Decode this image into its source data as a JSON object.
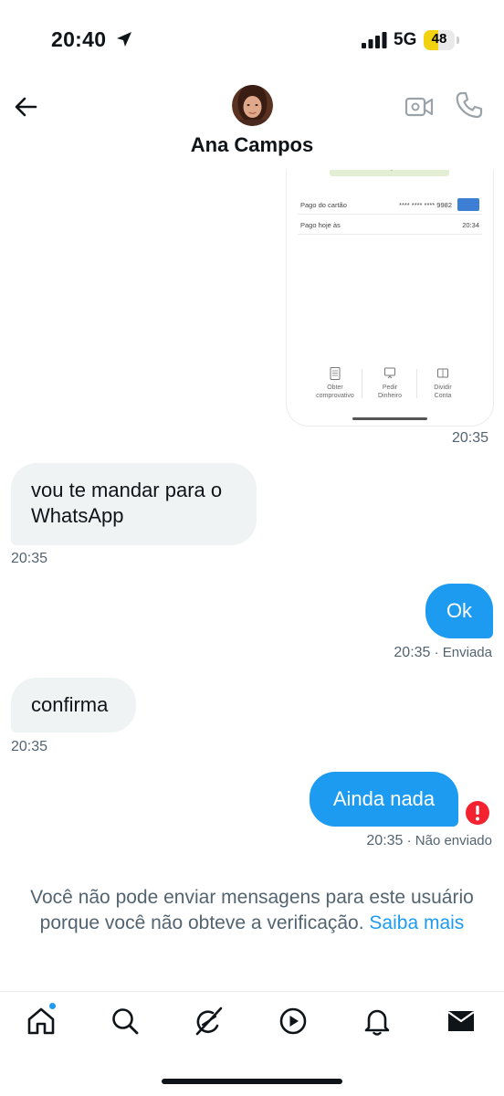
{
  "status_bar": {
    "time": "20:40",
    "network": "5G",
    "battery": "48",
    "battery_level": 0.48
  },
  "header": {
    "contact_name": "Ana Campos",
    "icons": [
      "back-arrow-icon",
      "video-camera-icon",
      "phone-icon"
    ]
  },
  "image_message": {
    "pago_label": "Pago",
    "card_label": "Pago do cartão",
    "card_number": "**** **** **** 9982",
    "paid_label": "Pago hoje às",
    "paid_time": "20:34",
    "actions": [
      {
        "line1": "Obter",
        "line2": "comprovativo"
      },
      {
        "line1": "Pedir",
        "line2": "Dinheiro"
      },
      {
        "line1": "Dividir",
        "line2": "Conta"
      }
    ],
    "timestamp": "20:35"
  },
  "messages": [
    {
      "direction": "in",
      "line1": "vou te mandar para o",
      "line2": "WhatsApp",
      "time": "20:35"
    },
    {
      "direction": "out",
      "text": "Ok",
      "time": "20:35",
      "status": " · Enviada"
    },
    {
      "direction": "in",
      "text": "confirma",
      "time": "20:35"
    },
    {
      "direction": "out",
      "text": "Ainda nada",
      "time": "20:35",
      "status": " · Não enviado",
      "error": true
    }
  ],
  "notice": {
    "line1": "Você não pode enviar mensagens para este usuário",
    "line2": "porque você não obteve a verificação.",
    "link": "Saiba mais"
  },
  "bottom_nav": {
    "items": [
      "home-icon",
      "search-icon",
      "grok-icon",
      "video-play-icon",
      "notifications-bell-icon",
      "messages-envelope-icon"
    ],
    "accent": "#1d9bf0"
  },
  "colors": {
    "accent": "#1d9bf0",
    "incoming_bubble": "#eff3f4",
    "secondary_text": "#536471",
    "error": "#f4212e"
  }
}
